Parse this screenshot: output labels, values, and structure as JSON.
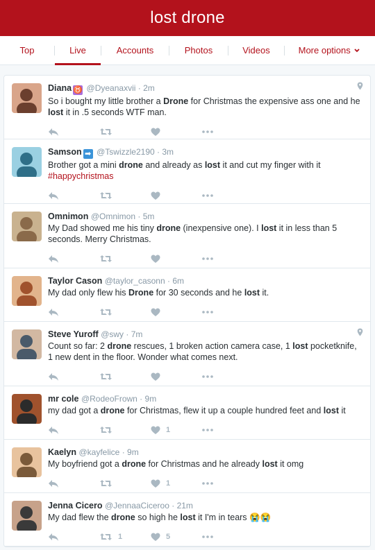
{
  "header": {
    "title": "lost drone"
  },
  "tabs": [
    {
      "label": "Top"
    },
    {
      "label": "Live"
    },
    {
      "label": "Accounts"
    },
    {
      "label": "Photos"
    },
    {
      "label": "Videos"
    },
    {
      "label": "More options"
    }
  ],
  "colors": {
    "brand": "#b3121c",
    "muted": "#8899a6",
    "icon": "#aab8c2"
  },
  "tweets": [
    {
      "name": "Diana",
      "badge": "♉",
      "badge_color": "#a86edc",
      "handle": "@Dyeanaxvii",
      "time": "2m",
      "has_location": true,
      "text_parts": [
        "So i bought my little brother a ",
        "Drone",
        " for Christmas the expensive ass one and he ",
        "lost",
        " it in .5 seconds WTF man."
      ],
      "retweets": "",
      "likes": ""
    },
    {
      "name": "Samson",
      "badge": "➡",
      "badge_color": "#3b94d9",
      "handle": "@Tswizzle2190",
      "time": "3m",
      "has_location": false,
      "text_parts": [
        "Brother got a mini ",
        "drone",
        " and already as ",
        "lost",
        " it and cut my finger with it "
      ],
      "hashtag": "#happychristmas",
      "retweets": "",
      "likes": ""
    },
    {
      "name": "Omnimon",
      "handle": "@Omnimon",
      "time": "5m",
      "has_location": false,
      "text_parts": [
        "My Dad showed me his tiny ",
        "drone",
        " (inexpensive one).  I ",
        "lost",
        " it in less than 5 seconds.  Merry Christmas."
      ],
      "retweets": "",
      "likes": ""
    },
    {
      "name": "Taylor Cason",
      "handle": "@taylor_casonn",
      "time": "6m",
      "has_location": false,
      "text_parts": [
        "My dad only flew his ",
        "Drone",
        " for 30 seconds and he ",
        "lost",
        " it."
      ],
      "retweets": "",
      "likes": ""
    },
    {
      "name": "Steve Yuroff",
      "handle": "@swy",
      "time": "7m",
      "has_location": true,
      "text_parts": [
        "Count so far: 2 ",
        "drone",
        " rescues, 1 broken action camera case, 1  ",
        "lost",
        " pocketknife, 1 new dent in the floor. Wonder what comes next."
      ],
      "retweets": "",
      "likes": ""
    },
    {
      "name": "mr cole",
      "handle": "@RodeoFrown",
      "time": "9m",
      "has_location": false,
      "text_parts": [
        "my dad got a ",
        "drone",
        " for Christmas, flew it up a couple hundred feet and ",
        "lost",
        " it"
      ],
      "retweets": "",
      "likes": "1"
    },
    {
      "name": "Kaelyn",
      "handle": "@kayfelice",
      "time": "9m",
      "has_location": false,
      "text_parts": [
        "My boyfriend got a ",
        "drone",
        " for Christmas and he already ",
        "lost",
        " it omg"
      ],
      "retweets": "",
      "likes": "1"
    },
    {
      "name": "Jenna Cicero",
      "handle": "@JennaaCiceroo",
      "time": "21m",
      "has_location": false,
      "text_parts": [
        "My dad flew the ",
        "drone",
        " so high he ",
        "lost",
        " it I'm in tears 😭😭"
      ],
      "retweets": "1",
      "likes": "5"
    }
  ]
}
